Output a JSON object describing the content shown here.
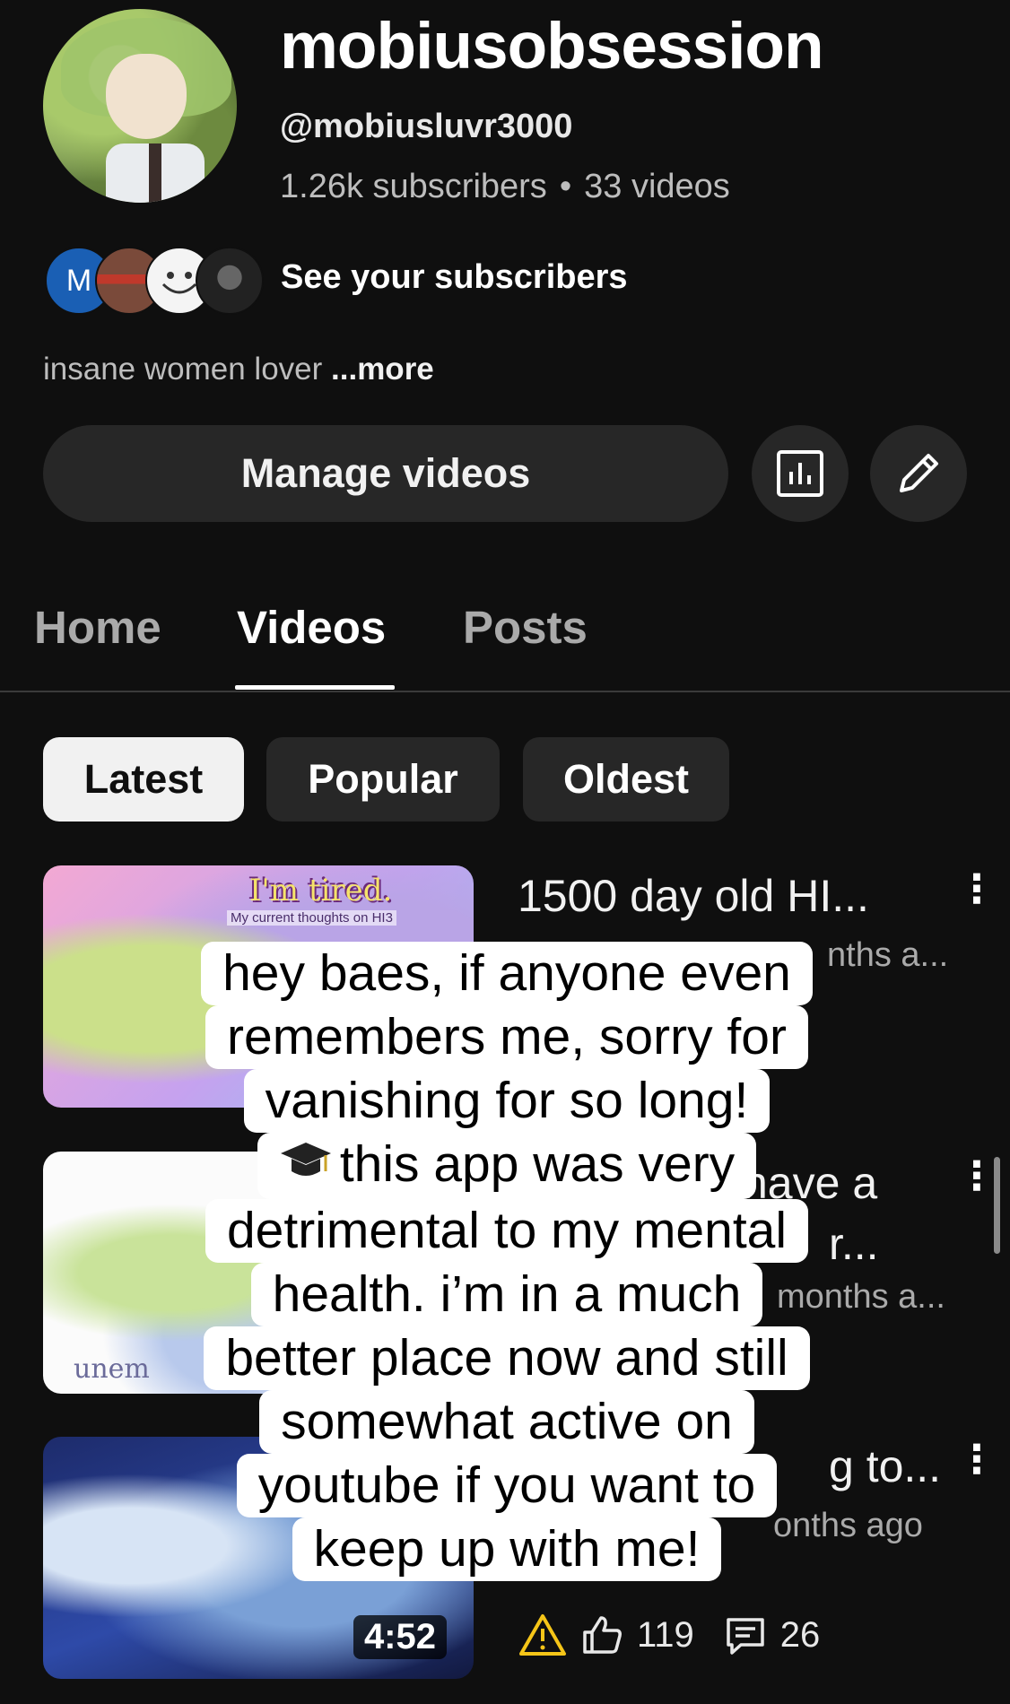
{
  "channel": {
    "name": "mobiusobsession",
    "handle": "@mobiusluvr3000",
    "subscribers": "1.26k subscribers",
    "separator": "•",
    "videos_count": "33 videos",
    "see_subscribers": "See your subscribers",
    "subscriber_avatar_initial": "M",
    "description": "insane women lover",
    "more_label": "...more"
  },
  "actions": {
    "manage_videos": "Manage videos"
  },
  "tabs": [
    {
      "label": "Home",
      "active": false
    },
    {
      "label": "Videos",
      "active": true
    },
    {
      "label": "Posts",
      "active": false
    }
  ],
  "filters": [
    {
      "label": "Latest",
      "active": true
    },
    {
      "label": "Popular",
      "active": false
    },
    {
      "label": "Oldest",
      "active": false
    }
  ],
  "videos": [
    {
      "title_visible": "1500 day old HI...",
      "meta_visible": "nths a...",
      "thumb_caption": "I'm tired.",
      "thumb_subcaption": "My current thoughts on HI3"
    },
    {
      "title_visible": "have a",
      "title_line2_visible": "r...",
      "meta_visible": "months a...",
      "thumb_caption": "unem"
    },
    {
      "title_visible": "g to...",
      "meta_visible": "onths ago",
      "duration": "4:52",
      "likes": "119",
      "comments": "26"
    }
  ],
  "overlay_text": [
    "hey baes, if anyone even",
    "remembers me, sorry for",
    "vanishing for so long!",
    "this app was very",
    "detrimental to my mental",
    "health. i’m in a much",
    "better place now and still",
    "somewhat active on",
    "youtube if you want to",
    "keep up with me!"
  ],
  "colors": {
    "background": "#0f0f0f",
    "surface": "#272727",
    "text_primary": "#f1f1f1",
    "text_secondary": "#aaaaaa",
    "warning": "#f5c518"
  },
  "icons": [
    "analytics-icon",
    "pencil-icon",
    "more-vert-icon",
    "warning-icon",
    "thumbs-up-icon",
    "comment-icon",
    "graduation-cap-icon"
  ]
}
